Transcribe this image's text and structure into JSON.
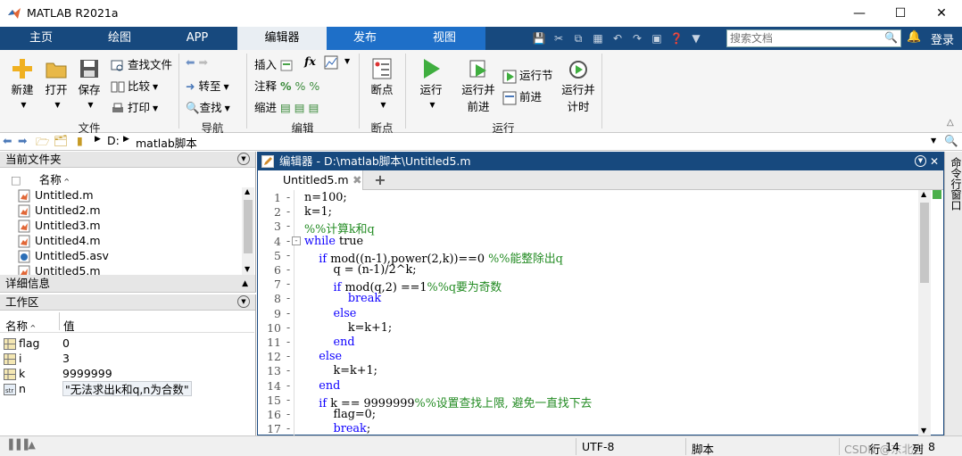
{
  "window": {
    "title": "MATLAB R2021a"
  },
  "tabs": [
    "主页",
    "绘图",
    "APP",
    "编辑器",
    "发布",
    "视图"
  ],
  "active_tab": "编辑器",
  "search": {
    "placeholder": "搜索文档"
  },
  "login_label": "登录",
  "ribbon": {
    "file": {
      "new": "新建",
      "open": "打开",
      "save": "保存",
      "find_files": "查找文件",
      "compare": "比较",
      "print": "打印",
      "group": "文件"
    },
    "nav": {
      "goto": "转至",
      "find": "查找",
      "group": "导航"
    },
    "edit": {
      "insert": "插入",
      "comment": "注释",
      "indent": "缩进",
      "fx": "fx",
      "group": "编辑"
    },
    "breakpoints": {
      "label": "断点",
      "group": "断点"
    },
    "run": {
      "run": "运行",
      "run_advance_1": "运行并",
      "run_advance_2": "前进",
      "run_section": "运行节",
      "advance": "前进",
      "run_time_1": "运行并",
      "run_time_2": "计时",
      "group": "运行"
    }
  },
  "path": {
    "drive": "D:",
    "folder": "matlab脚本"
  },
  "current_folder": {
    "title": "当前文件夹",
    "col_name": "名称",
    "files": [
      "Untitled.m",
      "Untitled2.m",
      "Untitled3.m",
      "Untitled4.m",
      "Untitled5.asv",
      "Untitled5.m"
    ]
  },
  "details": {
    "title": "详细信息"
  },
  "workspace": {
    "title": "工作区",
    "col_name": "名称",
    "col_value": "值",
    "vars": [
      {
        "name": "flag",
        "value": "0"
      },
      {
        "name": "i",
        "value": "3"
      },
      {
        "name": "k",
        "value": "9999999"
      },
      {
        "name": "n",
        "value": "\"无法求出k和q,n为合数\""
      }
    ]
  },
  "editor": {
    "header": "编辑器 - D:\\matlab脚本\\Untitled5.m",
    "tab": "Untitled5.m",
    "lines": [
      {
        "n": "1",
        "parts": [
          [
            "",
            "n=100;"
          ]
        ]
      },
      {
        "n": "2",
        "parts": [
          [
            "",
            "k=1;"
          ]
        ]
      },
      {
        "n": "3",
        "parts": [
          [
            "cm",
            "%%计算k和q"
          ]
        ]
      },
      {
        "n": "4",
        "parts": [
          [
            "kw",
            "while"
          ],
          [
            "",
            " true"
          ]
        ]
      },
      {
        "n": "5",
        "parts": [
          [
            "",
            "    "
          ],
          [
            "kw",
            "if"
          ],
          [
            "",
            " mod((n-1),power(2,k))==0 "
          ],
          [
            "cm",
            "%%能整除出q"
          ]
        ]
      },
      {
        "n": "6",
        "parts": [
          [
            "",
            "        q = (n-1)/2^k;"
          ]
        ]
      },
      {
        "n": "7",
        "parts": [
          [
            "",
            "        "
          ],
          [
            "kw",
            "if"
          ],
          [
            "",
            " mod(q,2) ==1"
          ],
          [
            "cm",
            "%%q要为奇数"
          ]
        ]
      },
      {
        "n": "8",
        "parts": [
          [
            "",
            "            "
          ],
          [
            "kw",
            "break"
          ]
        ]
      },
      {
        "n": "9",
        "parts": [
          [
            "",
            "        "
          ],
          [
            "kw",
            "else"
          ]
        ]
      },
      {
        "n": "10",
        "parts": [
          [
            "",
            "            k=k+1;"
          ]
        ]
      },
      {
        "n": "11",
        "parts": [
          [
            "",
            "        "
          ],
          [
            "kw",
            "end"
          ]
        ]
      },
      {
        "n": "12",
        "parts": [
          [
            "",
            "    "
          ],
          [
            "kw",
            "else"
          ]
        ]
      },
      {
        "n": "13",
        "parts": [
          [
            "",
            "        k=k+1;"
          ]
        ]
      },
      {
        "n": "14",
        "parts": [
          [
            "",
            "    "
          ],
          [
            "kw",
            "end"
          ]
        ]
      },
      {
        "n": "15",
        "parts": [
          [
            "",
            "    "
          ],
          [
            "kw",
            "if"
          ],
          [
            "",
            " k == 9999999"
          ],
          [
            "cm",
            "%%设置查找上限, 避免一直找下去"
          ]
        ]
      },
      {
        "n": "16",
        "parts": [
          [
            "",
            "        flag=0;"
          ]
        ]
      },
      {
        "n": "17",
        "parts": [
          [
            "",
            "        "
          ],
          [
            "kw",
            "break"
          ],
          [
            "",
            ";"
          ]
        ]
      }
    ]
  },
  "right_panel": {
    "label": "命令行窗口"
  },
  "status": {
    "encoding": "UTF-8",
    "type": "脚本",
    "row_label": "行",
    "row": "14",
    "col_label": "列",
    "col": "8",
    "watermark": "CSDN @东北吉"
  },
  "colors": {
    "tabbar": "#17497e",
    "keyword": "#0e00ff",
    "comment": "#228b22"
  }
}
